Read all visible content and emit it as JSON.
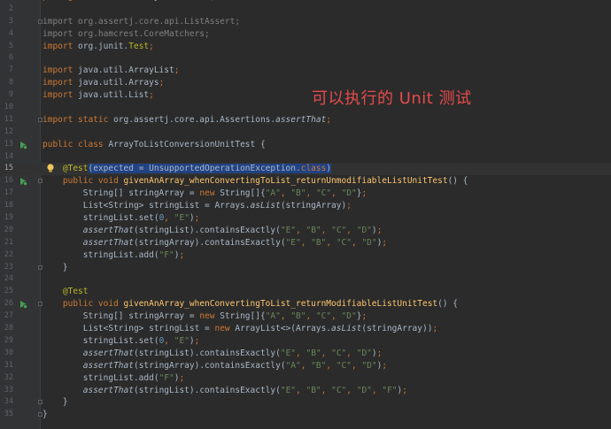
{
  "annotation": "可以执行的 Unit 测试",
  "lines": [
    {
      "n": "1",
      "parts": [
        [
          "kw",
          "package "
        ],
        [
          "",
          "com.ossez.arrayconversion"
        ],
        [
          "kw",
          ";"
        ]
      ]
    },
    {
      "n": "2",
      "parts": []
    },
    {
      "n": "3",
      "fold": true,
      "parts": [
        [
          "dim",
          "import org.assertj.core.api.ListAssert;"
        ]
      ]
    },
    {
      "n": "4",
      "parts": [
        [
          "dim",
          "import org.hamcrest.CoreMatchers;"
        ]
      ]
    },
    {
      "n": "5",
      "parts": [
        [
          "kw",
          "import "
        ],
        [
          "",
          "org.junit."
        ],
        [
          "ann",
          "Test"
        ],
        [
          "kw",
          ";"
        ]
      ]
    },
    {
      "n": "6",
      "parts": []
    },
    {
      "n": "7",
      "parts": [
        [
          "kw",
          "import "
        ],
        [
          "",
          "java.util.ArrayList"
        ],
        [
          "kw",
          ";"
        ]
      ]
    },
    {
      "n": "8",
      "parts": [
        [
          "kw",
          "import "
        ],
        [
          "",
          "java.util.Arrays"
        ],
        [
          "kw",
          ";"
        ]
      ]
    },
    {
      "n": "9",
      "parts": [
        [
          "kw",
          "import "
        ],
        [
          "",
          "java.util.List"
        ],
        [
          "kw",
          ";"
        ]
      ]
    },
    {
      "n": "10",
      "parts": []
    },
    {
      "n": "11",
      "fold": true,
      "parts": [
        [
          "kw",
          "import static "
        ],
        [
          "",
          "org.assertj.core.api.Assertions."
        ],
        [
          "it",
          "assertThat"
        ],
        [
          "kw",
          ";"
        ]
      ]
    },
    {
      "n": "12",
      "parts": []
    },
    {
      "n": "13",
      "run": true,
      "parts": [
        [
          "kw",
          "public class "
        ],
        [
          "",
          "ArrayToListConversionUnitTest {"
        ]
      ]
    },
    {
      "n": "14",
      "parts": []
    },
    {
      "n": "15",
      "current": true,
      "bulb": true,
      "parts": [
        [
          "",
          "    "
        ],
        [
          "ann",
          "@Test"
        ],
        [
          "sel",
          "(expected = UnsupportedOperationException."
        ],
        [
          "sel kw",
          "class"
        ],
        [
          "sel",
          ")"
        ]
      ]
    },
    {
      "n": "16",
      "run": true,
      "fold": true,
      "parts": [
        [
          "",
          "    "
        ],
        [
          "kw",
          "public void "
        ],
        [
          "fn",
          "givenAnArray_whenConvertingToList_returnUnmodifiableListUnitTest"
        ],
        [
          "",
          "() {"
        ]
      ]
    },
    {
      "n": "17",
      "parts": [
        [
          "",
          "        String[] stringArray = "
        ],
        [
          "kw",
          "new "
        ],
        [
          "",
          "String[]{"
        ],
        [
          "str",
          "\"A\""
        ],
        [
          "kw",
          ", "
        ],
        [
          "str",
          "\"B\""
        ],
        [
          "kw",
          ", "
        ],
        [
          "str",
          "\"C\""
        ],
        [
          "kw",
          ", "
        ],
        [
          "str",
          "\"D\""
        ],
        [
          "",
          "}"
        ],
        [
          "kw",
          ";"
        ]
      ]
    },
    {
      "n": "18",
      "parts": [
        [
          "",
          "        List<String> stringList = Arrays."
        ],
        [
          "it",
          "asList"
        ],
        [
          "",
          "(stringArray)"
        ],
        [
          "kw",
          ";"
        ]
      ]
    },
    {
      "n": "19",
      "parts": [
        [
          "",
          "        stringList.set("
        ],
        [
          "num",
          "0"
        ],
        [
          "kw",
          ", "
        ],
        [
          "str",
          "\"E\""
        ],
        [
          "",
          ")"
        ],
        [
          "kw",
          ";"
        ]
      ]
    },
    {
      "n": "20",
      "parts": [
        [
          "",
          "        "
        ],
        [
          "it",
          "assertThat"
        ],
        [
          "",
          "(stringList).containsExactly("
        ],
        [
          "str",
          "\"E\""
        ],
        [
          "kw",
          ", "
        ],
        [
          "str",
          "\"B\""
        ],
        [
          "kw",
          ", "
        ],
        [
          "str",
          "\"C\""
        ],
        [
          "kw",
          ", "
        ],
        [
          "str",
          "\"D\""
        ],
        [
          "",
          ")"
        ],
        [
          "kw",
          ";"
        ]
      ]
    },
    {
      "n": "21",
      "parts": [
        [
          "",
          "        "
        ],
        [
          "it",
          "assertThat"
        ],
        [
          "",
          "(stringArray).containsExactly("
        ],
        [
          "str",
          "\"E\""
        ],
        [
          "kw",
          ", "
        ],
        [
          "str",
          "\"B\""
        ],
        [
          "kw",
          ", "
        ],
        [
          "str",
          "\"C\""
        ],
        [
          "kw",
          ", "
        ],
        [
          "str",
          "\"D\""
        ],
        [
          "",
          ")"
        ],
        [
          "kw",
          ";"
        ]
      ]
    },
    {
      "n": "22",
      "parts": [
        [
          "",
          "        stringList.add("
        ],
        [
          "str",
          "\"F\""
        ],
        [
          "",
          ")"
        ],
        [
          "kw",
          ";"
        ]
      ]
    },
    {
      "n": "23",
      "fold": true,
      "parts": [
        [
          "",
          "    }"
        ]
      ]
    },
    {
      "n": "24",
      "parts": []
    },
    {
      "n": "25",
      "parts": [
        [
          "",
          "    "
        ],
        [
          "ann",
          "@Test"
        ]
      ]
    },
    {
      "n": "26",
      "run": true,
      "fold": true,
      "parts": [
        [
          "",
          "    "
        ],
        [
          "kw",
          "public void "
        ],
        [
          "fn",
          "givenAnArray_whenConvertingToList_returnModifiableListUnitTest"
        ],
        [
          "",
          "() {"
        ]
      ]
    },
    {
      "n": "27",
      "parts": [
        [
          "",
          "        String[] stringArray = "
        ],
        [
          "kw",
          "new "
        ],
        [
          "",
          "String[]{"
        ],
        [
          "str",
          "\"A\""
        ],
        [
          "kw",
          ", "
        ],
        [
          "str",
          "\"B\""
        ],
        [
          "kw",
          ", "
        ],
        [
          "str",
          "\"C\""
        ],
        [
          "kw",
          ", "
        ],
        [
          "str",
          "\"D\""
        ],
        [
          "",
          "}"
        ],
        [
          "kw",
          ";"
        ]
      ]
    },
    {
      "n": "28",
      "parts": [
        [
          "",
          "        List<String> stringList = "
        ],
        [
          "kw",
          "new "
        ],
        [
          "",
          "ArrayList<>(Arrays."
        ],
        [
          "it",
          "asList"
        ],
        [
          "",
          "(stringArray))"
        ],
        [
          "kw",
          ";"
        ]
      ]
    },
    {
      "n": "29",
      "parts": [
        [
          "",
          "        stringList.set("
        ],
        [
          "num",
          "0"
        ],
        [
          "kw",
          ", "
        ],
        [
          "str",
          "\"E\""
        ],
        [
          "",
          ")"
        ],
        [
          "kw",
          ";"
        ]
      ]
    },
    {
      "n": "30",
      "parts": [
        [
          "",
          "        "
        ],
        [
          "it",
          "assertThat"
        ],
        [
          "",
          "(stringList).containsExactly("
        ],
        [
          "str",
          "\"E\""
        ],
        [
          "kw",
          ", "
        ],
        [
          "str",
          "\"B\""
        ],
        [
          "kw",
          ", "
        ],
        [
          "str",
          "\"C\""
        ],
        [
          "kw",
          ", "
        ],
        [
          "str",
          "\"D\""
        ],
        [
          "",
          ")"
        ],
        [
          "kw",
          ";"
        ]
      ]
    },
    {
      "n": "31",
      "parts": [
        [
          "",
          "        "
        ],
        [
          "it",
          "assertThat"
        ],
        [
          "",
          "(stringArray).containsExactly("
        ],
        [
          "str",
          "\"A\""
        ],
        [
          "kw",
          ", "
        ],
        [
          "str",
          "\"B\""
        ],
        [
          "kw",
          ", "
        ],
        [
          "str",
          "\"C\""
        ],
        [
          "kw",
          ", "
        ],
        [
          "str",
          "\"D\""
        ],
        [
          "",
          ")"
        ],
        [
          "kw",
          ";"
        ]
      ]
    },
    {
      "n": "32",
      "parts": [
        [
          "",
          "        stringList.add("
        ],
        [
          "str",
          "\"F\""
        ],
        [
          "",
          ")"
        ],
        [
          "kw",
          ";"
        ]
      ]
    },
    {
      "n": "33",
      "parts": [
        [
          "",
          "        "
        ],
        [
          "it",
          "assertThat"
        ],
        [
          "",
          "(stringList).containsExactly("
        ],
        [
          "str",
          "\"E\""
        ],
        [
          "kw",
          ", "
        ],
        [
          "str",
          "\"B\""
        ],
        [
          "kw",
          ", "
        ],
        [
          "str",
          "\"C\""
        ],
        [
          "kw",
          ", "
        ],
        [
          "str",
          "\"D\""
        ],
        [
          "kw",
          ", "
        ],
        [
          "str",
          "\"F\""
        ],
        [
          "",
          ")"
        ],
        [
          "kw",
          ";"
        ]
      ]
    },
    {
      "n": "34",
      "fold": true,
      "parts": [
        [
          "",
          "    }"
        ]
      ]
    },
    {
      "n": "35",
      "fold": true,
      "parts": [
        [
          "",
          "}"
        ]
      ]
    }
  ],
  "colors": {
    "background": "#2b2b2b",
    "gutter": "#313335",
    "keyword": "#cc7832",
    "string": "#6a8759",
    "annotation": "#bbb529",
    "method": "#ffc66d",
    "selection": "#214283",
    "note": "#e64b4b"
  },
  "icons": {
    "run": "run-test-icon",
    "bulb": "intention-bulb-icon",
    "fold": "fold-marker-icon"
  }
}
